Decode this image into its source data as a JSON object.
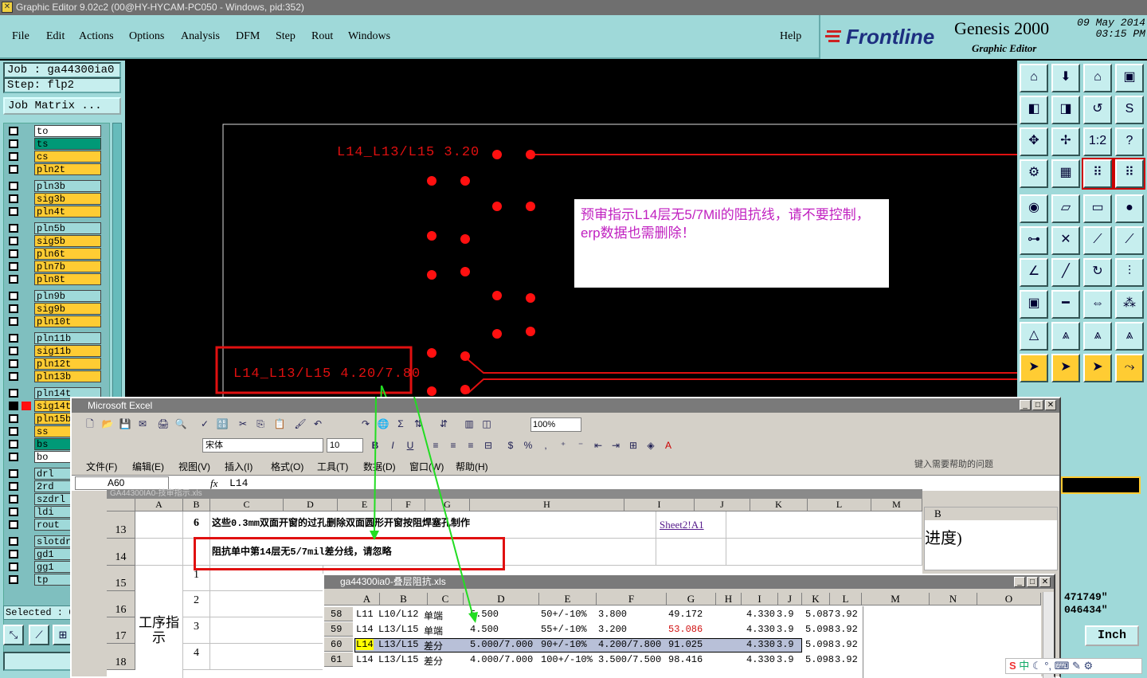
{
  "window": {
    "title": "Graphic Editor 9.02c2 (00@HY-HYCAM-PC050 - Windows, pid:352)"
  },
  "menu": {
    "file": "File",
    "edit": "Edit",
    "actions": "Actions",
    "options": "Options",
    "analysis": "Analysis",
    "dfm": "DFM",
    "step": "Step",
    "rout": "Rout",
    "windows": "Windows",
    "help": "Help"
  },
  "brand": {
    "logo": "Frontline",
    "product": "Genesis 2000",
    "subtitle": "Graphic Editor",
    "date": "09 May 2014",
    "time": "03:15 PM"
  },
  "job": {
    "job_line": "Job : ga44300ia0",
    "step_line": "Step: flp2",
    "matrix_button": "Job Matrix ...",
    "selected": "Selected : 0"
  },
  "layers": [
    {
      "name": "to",
      "color": "#ffffff"
    },
    {
      "name": "ts",
      "color": "#009977"
    },
    {
      "name": "cs",
      "color": "#ffcc33"
    },
    {
      "name": "pln2t",
      "color": "#ffcc33"
    },
    {
      "name": "pln3b",
      "color": "#9fd9d9"
    },
    {
      "name": "sig3b",
      "color": "#ffcc33"
    },
    {
      "name": "pln4t",
      "color": "#ffcc33"
    },
    {
      "name": "pln5b",
      "color": "#9fd9d9"
    },
    {
      "name": "sig5b",
      "color": "#ffcc33"
    },
    {
      "name": "pln6t",
      "color": "#ffcc33"
    },
    {
      "name": "pln7b",
      "color": "#ffcc33"
    },
    {
      "name": "pln8t",
      "color": "#ffcc33"
    },
    {
      "name": "pln9b",
      "color": "#9fd9d9"
    },
    {
      "name": "sig9b",
      "color": "#ffcc33"
    },
    {
      "name": "pln10t",
      "color": "#ffcc33"
    },
    {
      "name": "pln11b",
      "color": "#9fd9d9"
    },
    {
      "name": "sig11b",
      "color": "#ffcc33"
    },
    {
      "name": "pln12t",
      "color": "#ffcc33"
    },
    {
      "name": "pln13b",
      "color": "#ffcc33"
    },
    {
      "name": "pln14t",
      "color": "#9fd9d9"
    },
    {
      "name": "sig14t",
      "color": "#ffcc33"
    },
    {
      "name": "pln15b",
      "color": "#ffcc33"
    },
    {
      "name": "ss",
      "color": "#ffcc33"
    },
    {
      "name": "bs",
      "color": "#009977"
    },
    {
      "name": "bo",
      "color": "#ffffff"
    },
    {
      "name": "drl",
      "color": "#9fd9d9"
    },
    {
      "name": "2rd",
      "color": "#9fd9d9"
    },
    {
      "name": "szdrl",
      "color": "#9fd9d9"
    },
    {
      "name": "ldi",
      "color": "#9fd9d9"
    },
    {
      "name": "rout",
      "color": "#9fd9d9"
    },
    {
      "name": "slotdr",
      "color": "#9fd9d9"
    },
    {
      "name": "gd1",
      "color": "#9fd9d9"
    },
    {
      "name": "gg1",
      "color": "#9fd9d9"
    },
    {
      "name": "tp",
      "color": "#9fd9d9"
    }
  ],
  "canvas": {
    "label1": "L14_L13/L15 3.20",
    "label2": "L14_L13/L15 4.20/7.80",
    "note": "预审指示L14层无5/7Mil的阻抗线，请不要控制，erp数据也需删除！"
  },
  "status": {
    "coord_x": "471749\"",
    "coord_y": "046434\"",
    "unit": "Inch"
  },
  "excel": {
    "title": "Microsoft Excel",
    "font": "宋体",
    "size": "10",
    "zoom": "100%",
    "menus": [
      "文件(F)",
      "编辑(E)",
      "视图(V)",
      "插入(I)",
      "格式(O)",
      "工具(T)",
      "数据(D)",
      "窗口(W)",
      "帮助(H)"
    ],
    "help_box": "键入需要帮助的问题",
    "name_box": "A60",
    "formula": "L14",
    "sheet_title": "GA44300IA0-技审指示.xls",
    "cols": [
      "A",
      "B",
      "C",
      "D",
      "E",
      "F",
      "G",
      "H",
      "I",
      "J",
      "K",
      "L",
      "M"
    ],
    "row13": {
      "num": "13",
      "b": "6",
      "c": "这些0.3mm双面开窗的过孔删除双面圆形开窗按阻焊塞孔制作",
      "j": "Sheet2!A1"
    },
    "row14": {
      "num": "14",
      "c": "阻抗单中第14层无5/7mil差分线，请忽略"
    },
    "rows_low": [
      {
        "num": "15",
        "b": "1"
      },
      {
        "num": "16",
        "b": "2"
      },
      {
        "num": "17",
        "b": "3"
      },
      {
        "num": "18",
        "b": "4"
      }
    ],
    "group_label": "工序指示",
    "side_col": "B",
    "side_text": "进度)"
  },
  "inner_xls": {
    "title": "ga44300ia0-叠层阻抗.xls",
    "cols": [
      "A",
      "B",
      "C",
      "D",
      "E",
      "F",
      "G",
      "H",
      "I",
      "J",
      "K",
      "L",
      "M",
      "N",
      "O"
    ],
    "rows": [
      {
        "num": "58",
        "a": "L11",
        "b": "L10/L12",
        "c": "单端",
        "d": "5.500",
        "e": "50+/-10%",
        "f": "3.800",
        "g": "49.172",
        "i": "4.330",
        "j": "3.9",
        "k": "5.087",
        "l": "3.92"
      },
      {
        "num": "59",
        "a": "L14",
        "b": "L13/L15",
        "c": "单端",
        "d": "4.500",
        "e": "55+/-10%",
        "f": "3.200",
        "g": "53.086",
        "i": "4.330",
        "j": "3.9",
        "k": "5.098",
        "l": "3.92"
      },
      {
        "num": "60",
        "a": "L14",
        "b": "L13/L15",
        "c": "差分",
        "d": "5.000/7.000",
        "e": "90+/-10%",
        "f": "4.200/7.800",
        "g": "91.025",
        "i": "4.330",
        "j": "3.9",
        "k": "5.098",
        "l": "3.92"
      },
      {
        "num": "61",
        "a": "L14",
        "b": "L13/L15",
        "c": "差分",
        "d": "4.000/7.000",
        "e": "100+/-10%",
        "f": "3.500/7.500",
        "g": "98.416",
        "i": "4.330",
        "j": "3.9",
        "k": "5.098",
        "l": "3.92"
      }
    ]
  },
  "ime": {
    "lang": "中"
  }
}
